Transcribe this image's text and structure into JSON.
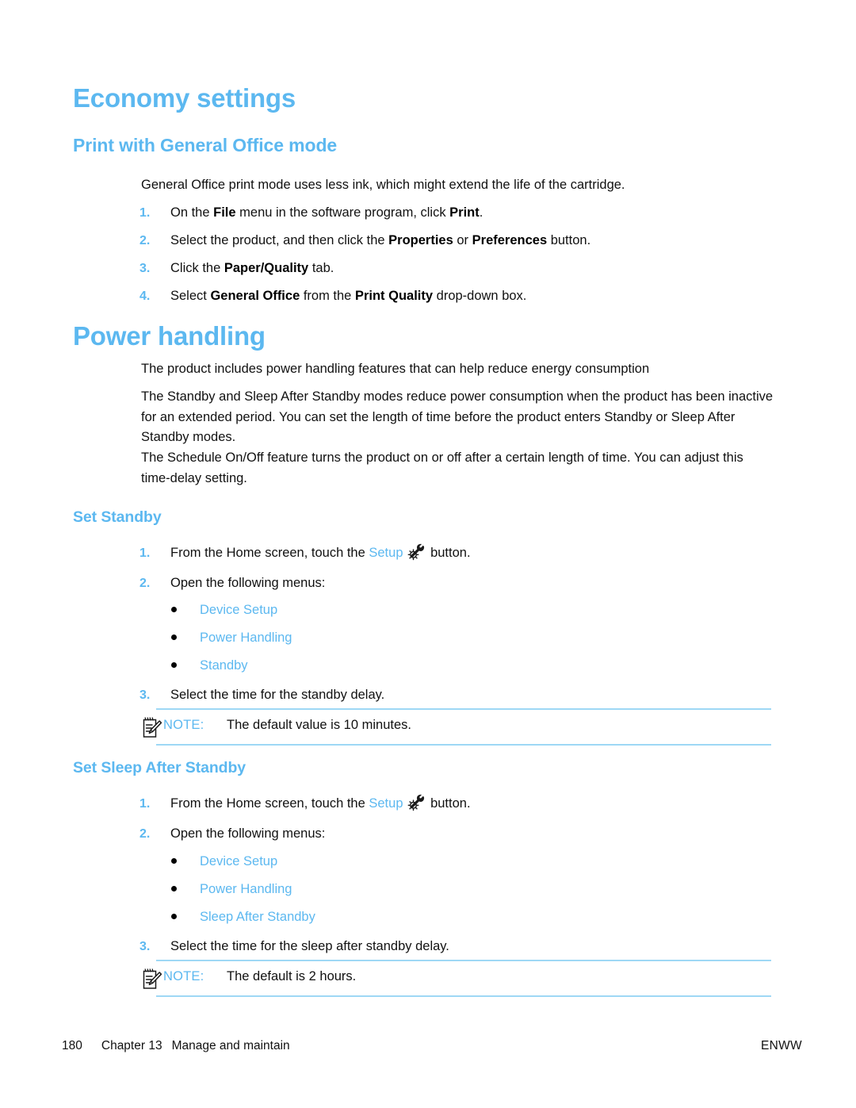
{
  "page": {
    "title": "Economy settings",
    "accent_color": "#5cb8f0",
    "rule_color": "#9ed8f5",
    "body_color": "#111111"
  },
  "section_office": {
    "heading": "Print with General Office mode",
    "intro": "General Office print mode uses less ink, which might extend the life of the cartridge.",
    "steps": [
      {
        "num": "1.",
        "pre": "On the ",
        "b1": "File",
        "mid": " menu in the software program, click ",
        "b2": "Print",
        "post": "."
      },
      {
        "num": "2.",
        "pre": "Select the product, and then click the ",
        "b1": "Properties",
        "mid": " or ",
        "b2": "Preferences",
        "post": " button."
      },
      {
        "num": "3.",
        "pre": "Click the ",
        "b1": "Paper/Quality",
        "mid": "",
        "b2": "",
        "post": " tab."
      },
      {
        "num": "4.",
        "pre": "Select ",
        "b1": "General Office",
        "mid": " from the ",
        "b2": "Print Quality",
        "post": " drop-down box."
      }
    ]
  },
  "section_power": {
    "heading": "Power handling",
    "paragraphs": [
      "The product includes power handling features that can help reduce energy consumption",
      "The Standby and Sleep After Standby modes reduce power consumption when the product has been inactive for an extended period. You can set the length of time before the product enters Standby or Sleep After Standby modes.",
      "The Schedule On/Off feature turns the product on or off after a certain length of time. You can adjust this time-delay setting."
    ]
  },
  "section_standby": {
    "heading": "Set Standby",
    "step1_num": "1.",
    "step1_pre": "From the Home screen, touch the ",
    "step1_link": "Setup",
    "step1_post": " button.",
    "step2_num": "2.",
    "step2_text": "Open the following menus:",
    "menus": [
      "Device Setup",
      "Power Handling",
      "Standby"
    ],
    "step3_num": "3.",
    "step3_text": "Select the time for the standby delay.",
    "note_label": "NOTE:",
    "note_text": "The default value is 10 minutes."
  },
  "section_sleep": {
    "heading": "Set Sleep After Standby",
    "step1_num": "1.",
    "step1_pre": "From the Home screen, touch the ",
    "step1_link": "Setup",
    "step1_post": " button.",
    "step2_num": "2.",
    "step2_text": "Open the following menus:",
    "menus": [
      "Device Setup",
      "Power Handling",
      "Sleep After Standby"
    ],
    "step3_num": "3.",
    "step3_text": "Select the time for the sleep after standby delay.",
    "note_label": "NOTE:",
    "note_text": "The default is 2 hours."
  },
  "footer": {
    "page_number": "180",
    "chapter": "Chapter 13",
    "chapter_title": "Manage and maintain",
    "right": "ENWW"
  }
}
